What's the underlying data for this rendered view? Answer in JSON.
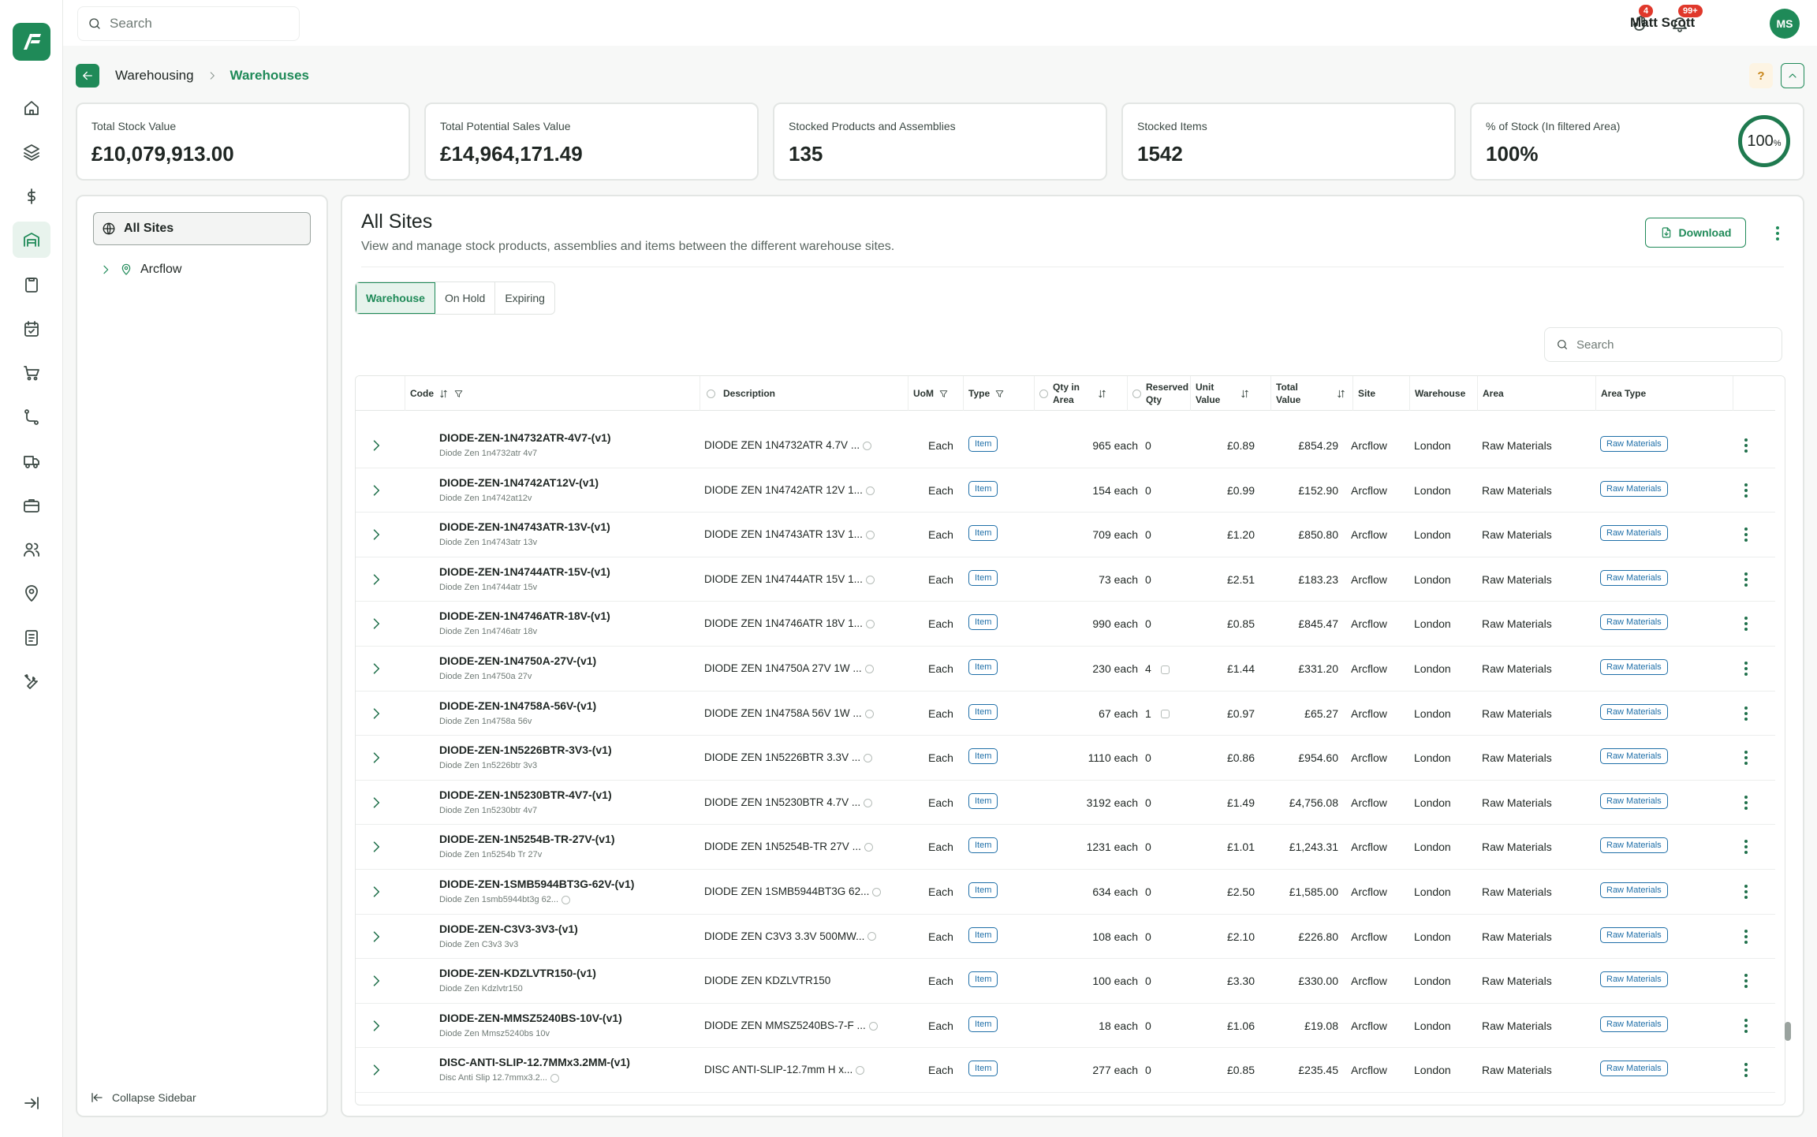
{
  "app": {
    "logo_text": "AF",
    "accent": "#1f8a58"
  },
  "topbar": {
    "search_placeholder": "Search",
    "tasks_badge": "4",
    "notifications_badge": "99+",
    "user_name": "Matt Scott",
    "user_initials": "MS"
  },
  "nav": [
    {
      "name": "home-icon"
    },
    {
      "name": "layers-icon"
    },
    {
      "name": "dollar-icon"
    },
    {
      "name": "warehouse-icon",
      "active": true
    },
    {
      "name": "clipboard-icon"
    },
    {
      "name": "calendar-icon"
    },
    {
      "name": "cart-icon"
    },
    {
      "name": "route-icon"
    },
    {
      "name": "truck-icon"
    },
    {
      "name": "briefcase-icon"
    },
    {
      "name": "users-icon"
    },
    {
      "name": "location-icon"
    },
    {
      "name": "document-icon"
    },
    {
      "name": "tools-icon"
    }
  ],
  "breadcrumb": {
    "parent": "Warehousing",
    "current": "Warehouses",
    "help": "?"
  },
  "stats": [
    {
      "label": "Total Stock Value",
      "value": "£10,079,913.00"
    },
    {
      "label": "Total Potential Sales Value",
      "value": "£14,964,171.49"
    },
    {
      "label": "Stocked Products and Assemblies",
      "value": "135"
    },
    {
      "label": "Stocked Items",
      "value": "1542"
    },
    {
      "label": "% of Stock (In filtered Area)",
      "value": "100%",
      "ring": "100",
      "ring_unit": "%"
    }
  ],
  "sites": {
    "all": "All Sites",
    "children": [
      "Arcflow"
    ],
    "collapse": "Collapse Sidebar"
  },
  "panel": {
    "title": "All Sites",
    "subtitle": "View and manage stock products, assemblies and items between the different warehouse sites.",
    "download": "Download",
    "tabs": [
      {
        "label": "Warehouse",
        "active": true
      },
      {
        "label": "On Hold"
      },
      {
        "label": "Expiring"
      }
    ],
    "search_placeholder": "Search"
  },
  "table": {
    "headers": {
      "code": "Code",
      "description": "Description",
      "uom": "UoM",
      "type": "Type",
      "qty_1": "Qty in",
      "qty_2": "Area",
      "res_1": "Reserved",
      "res_2": "Qty",
      "unit_1": "Unit",
      "unit_2": "Value",
      "total_1": "Total",
      "total_2": "Value",
      "site": "Site",
      "warehouse": "Warehouse",
      "area": "Area",
      "area_type": "Area Type"
    },
    "rows": [
      {
        "code": "DIODE-ZEN-1N4732ATR-4V7-(v1)",
        "sub": "Diode Zen 1n4732atr 4v7",
        "desc": "DIODE ZEN 1N4732ATR 4.7V ...",
        "uom": "Each",
        "type": "Item",
        "qty": "965 each",
        "res": "0",
        "unit": "£0.89",
        "total": "£854.29",
        "site": "Arcflow",
        "wh": "London",
        "area": "Raw Materials",
        "atype": "Raw Materials"
      },
      {
        "code": "DIODE-ZEN-1N4742AT12V-(v1)",
        "sub": "Diode Zen 1n4742at12v",
        "desc": "DIODE ZEN 1N4742ATR 12V 1...",
        "uom": "Each",
        "type": "Item",
        "qty": "154 each",
        "res": "0",
        "unit": "£0.99",
        "total": "£152.90",
        "site": "Arcflow",
        "wh": "London",
        "area": "Raw Materials",
        "atype": "Raw Materials"
      },
      {
        "code": "DIODE-ZEN-1N4743ATR-13V-(v1)",
        "sub": "Diode Zen 1n4743atr 13v",
        "desc": "DIODE ZEN 1N4743ATR 13V 1...",
        "uom": "Each",
        "type": "Item",
        "qty": "709 each",
        "res": "0",
        "unit": "£1.20",
        "total": "£850.80",
        "site": "Arcflow",
        "wh": "London",
        "area": "Raw Materials",
        "atype": "Raw Materials"
      },
      {
        "code": "DIODE-ZEN-1N4744ATR-15V-(v1)",
        "sub": "Diode Zen 1n4744atr 15v",
        "desc": "DIODE ZEN 1N4744ATR 15V 1...",
        "uom": "Each",
        "type": "Item",
        "qty": "73 each",
        "res": "0",
        "unit": "£2.51",
        "total": "£183.23",
        "site": "Arcflow",
        "wh": "London",
        "area": "Raw Materials",
        "atype": "Raw Materials"
      },
      {
        "code": "DIODE-ZEN-1N4746ATR-18V-(v1)",
        "sub": "Diode Zen 1n4746atr 18v",
        "desc": "DIODE ZEN 1N4746ATR 18V 1...",
        "uom": "Each",
        "type": "Item",
        "qty": "990 each",
        "res": "0",
        "unit": "£0.85",
        "total": "£845.47",
        "site": "Arcflow",
        "wh": "London",
        "area": "Raw Materials",
        "atype": "Raw Materials"
      },
      {
        "code": "DIODE-ZEN-1N4750A-27V-(v1)",
        "sub": "Diode Zen 1n4750a 27v",
        "desc": "DIODE ZEN 1N4750A 27V 1W ...",
        "uom": "Each",
        "type": "Item",
        "qty": "230 each",
        "res": "4",
        "unit": "£1.44",
        "total": "£331.20",
        "site": "Arcflow",
        "wh": "London",
        "area": "Raw Materials",
        "atype": "Raw Materials"
      },
      {
        "code": "DIODE-ZEN-1N4758A-56V-(v1)",
        "sub": "Diode Zen 1n4758a 56v",
        "desc": "DIODE ZEN 1N4758A 56V 1W ...",
        "uom": "Each",
        "type": "Item",
        "qty": "67 each",
        "res": "1",
        "unit": "£0.97",
        "total": "£65.27",
        "site": "Arcflow",
        "wh": "London",
        "area": "Raw Materials",
        "atype": "Raw Materials"
      },
      {
        "code": "DIODE-ZEN-1N5226BTR-3V3-(v1)",
        "sub": "Diode Zen 1n5226btr 3v3",
        "desc": "DIODE ZEN 1N5226BTR 3.3V ...",
        "uom": "Each",
        "type": "Item",
        "qty": "1110 each",
        "res": "0",
        "unit": "£0.86",
        "total": "£954.60",
        "site": "Arcflow",
        "wh": "London",
        "area": "Raw Materials",
        "atype": "Raw Materials"
      },
      {
        "code": "DIODE-ZEN-1N5230BTR-4V7-(v1)",
        "sub": "Diode Zen 1n5230btr 4v7",
        "desc": "DIODE ZEN 1N5230BTR 4.7V ...",
        "uom": "Each",
        "type": "Item",
        "qty": "3192 each",
        "res": "0",
        "unit": "£1.49",
        "total": "£4,756.08",
        "site": "Arcflow",
        "wh": "London",
        "area": "Raw Materials",
        "atype": "Raw Materials"
      },
      {
        "code": "DIODE-ZEN-1N5254B-TR-27V-(v1)",
        "sub": "Diode Zen 1n5254b Tr 27v",
        "desc": "DIODE ZEN 1N5254B-TR 27V ...",
        "uom": "Each",
        "type": "Item",
        "qty": "1231 each",
        "res": "0",
        "unit": "£1.01",
        "total": "£1,243.31",
        "site": "Arcflow",
        "wh": "London",
        "area": "Raw Materials",
        "atype": "Raw Materials"
      },
      {
        "code": "DIODE-ZEN-1SMB5944BT3G-62V-(v1)",
        "sub": "Diode Zen 1smb5944bt3g 62...",
        "desc": "DIODE ZEN 1SMB5944BT3G 62...",
        "uom": "Each",
        "type": "Item",
        "qty": "634 each",
        "res": "0",
        "unit": "£2.50",
        "total": "£1,585.00",
        "site": "Arcflow",
        "wh": "London",
        "area": "Raw Materials",
        "atype": "Raw Materials"
      },
      {
        "code": "DIODE-ZEN-C3V3-3V3-(v1)",
        "sub": "Diode Zen C3v3 3v3",
        "desc": "DIODE ZEN C3V3 3.3V 500MW...",
        "uom": "Each",
        "type": "Item",
        "qty": "108 each",
        "res": "0",
        "unit": "£2.10",
        "total": "£226.80",
        "site": "Arcflow",
        "wh": "London",
        "area": "Raw Materials",
        "atype": "Raw Materials"
      },
      {
        "code": "DIODE-ZEN-KDZLVTR150-(v1)",
        "sub": "Diode Zen Kdzlvtr150",
        "desc": "DIODE ZEN KDZLVTR150",
        "uom": "Each",
        "type": "Item",
        "qty": "100 each",
        "res": "0",
        "unit": "£3.30",
        "total": "£330.00",
        "site": "Arcflow",
        "wh": "London",
        "area": "Raw Materials",
        "atype": "Raw Materials"
      },
      {
        "code": "DIODE-ZEN-MMSZ5240BS-10V-(v1)",
        "sub": "Diode Zen Mmsz5240bs 10v",
        "desc": "DIODE ZEN MMSZ5240BS-7-F ...",
        "uom": "Each",
        "type": "Item",
        "qty": "18 each",
        "res": "0",
        "unit": "£1.06",
        "total": "£19.08",
        "site": "Arcflow",
        "wh": "London",
        "area": "Raw Materials",
        "atype": "Raw Materials"
      },
      {
        "code": "DISC-ANTI-SLIP-12.7MMx3.2MM-(v1)",
        "sub": "Disc Anti Slip 12.7mmx3.2...",
        "desc": "DISC ANTI-SLIP-12.7mm H x...",
        "uom": "Each",
        "type": "Item",
        "qty": "277 each",
        "res": "0",
        "unit": "£0.85",
        "total": "£235.45",
        "site": "Arcflow",
        "wh": "London",
        "area": "Raw Materials",
        "atype": "Raw Materials"
      }
    ]
  }
}
